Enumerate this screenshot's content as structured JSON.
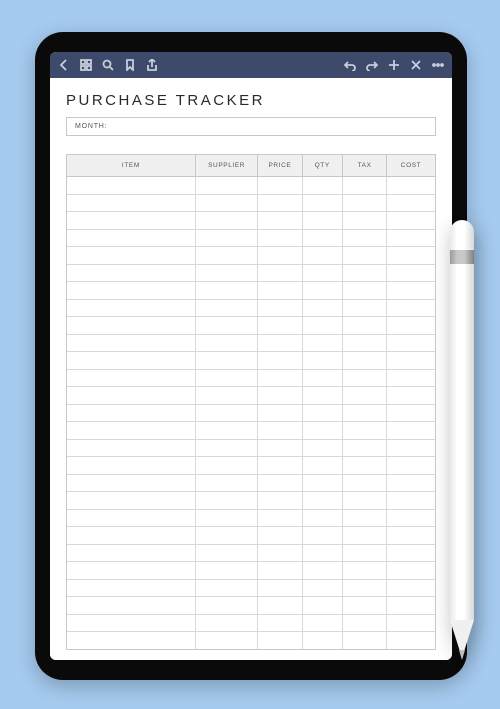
{
  "doc": {
    "title": "PURCHASE TRACKER",
    "month_label": "MONTH:",
    "columns": {
      "item": "ITEM",
      "supplier": "SUPPLIER",
      "price": "PRICE",
      "qty": "QTY",
      "tax": "TAX",
      "cost": "COST"
    },
    "row_count": 27
  },
  "toolbar": {
    "icons_left": [
      "back",
      "apps",
      "search",
      "bookmark",
      "share"
    ],
    "icons_right": [
      "undo",
      "redo",
      "add",
      "close",
      "more"
    ]
  }
}
